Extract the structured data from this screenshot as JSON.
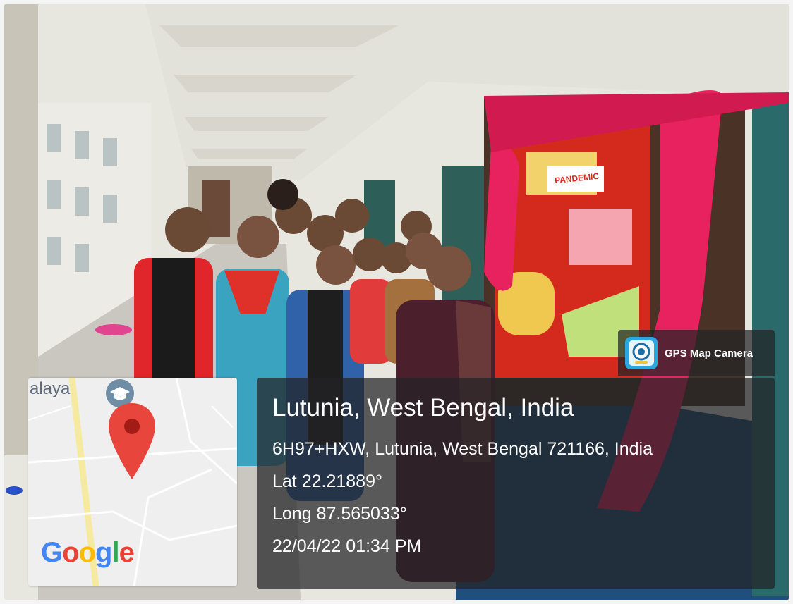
{
  "overlay": {
    "app_name": "GPS Map Camera",
    "location_title": "Lutunia, West Bengal, India",
    "address": "6H97+HXW, Lutunia, West Bengal 721166, India",
    "latitude": "Lat 22.21889°",
    "longitude": "Long 87.565033°",
    "datetime": "22/04/22 01:34 PM"
  },
  "map": {
    "place_label": "alaya",
    "place_icon": "school-icon",
    "pin_icon": "location-pin-icon",
    "logo_letters": [
      "G",
      "o",
      "o",
      "g",
      "l",
      "e"
    ],
    "logo_colors": [
      "#4285F4",
      "#EA4335",
      "#FBBC05",
      "#4285F4",
      "#34A853",
      "#EA4335"
    ],
    "pin_color": "#E8453C"
  },
  "photo": {
    "poster_text": [
      "PANDEMIC"
    ],
    "curtain_color": "#E8225E",
    "board_color": "#D42A1E"
  }
}
